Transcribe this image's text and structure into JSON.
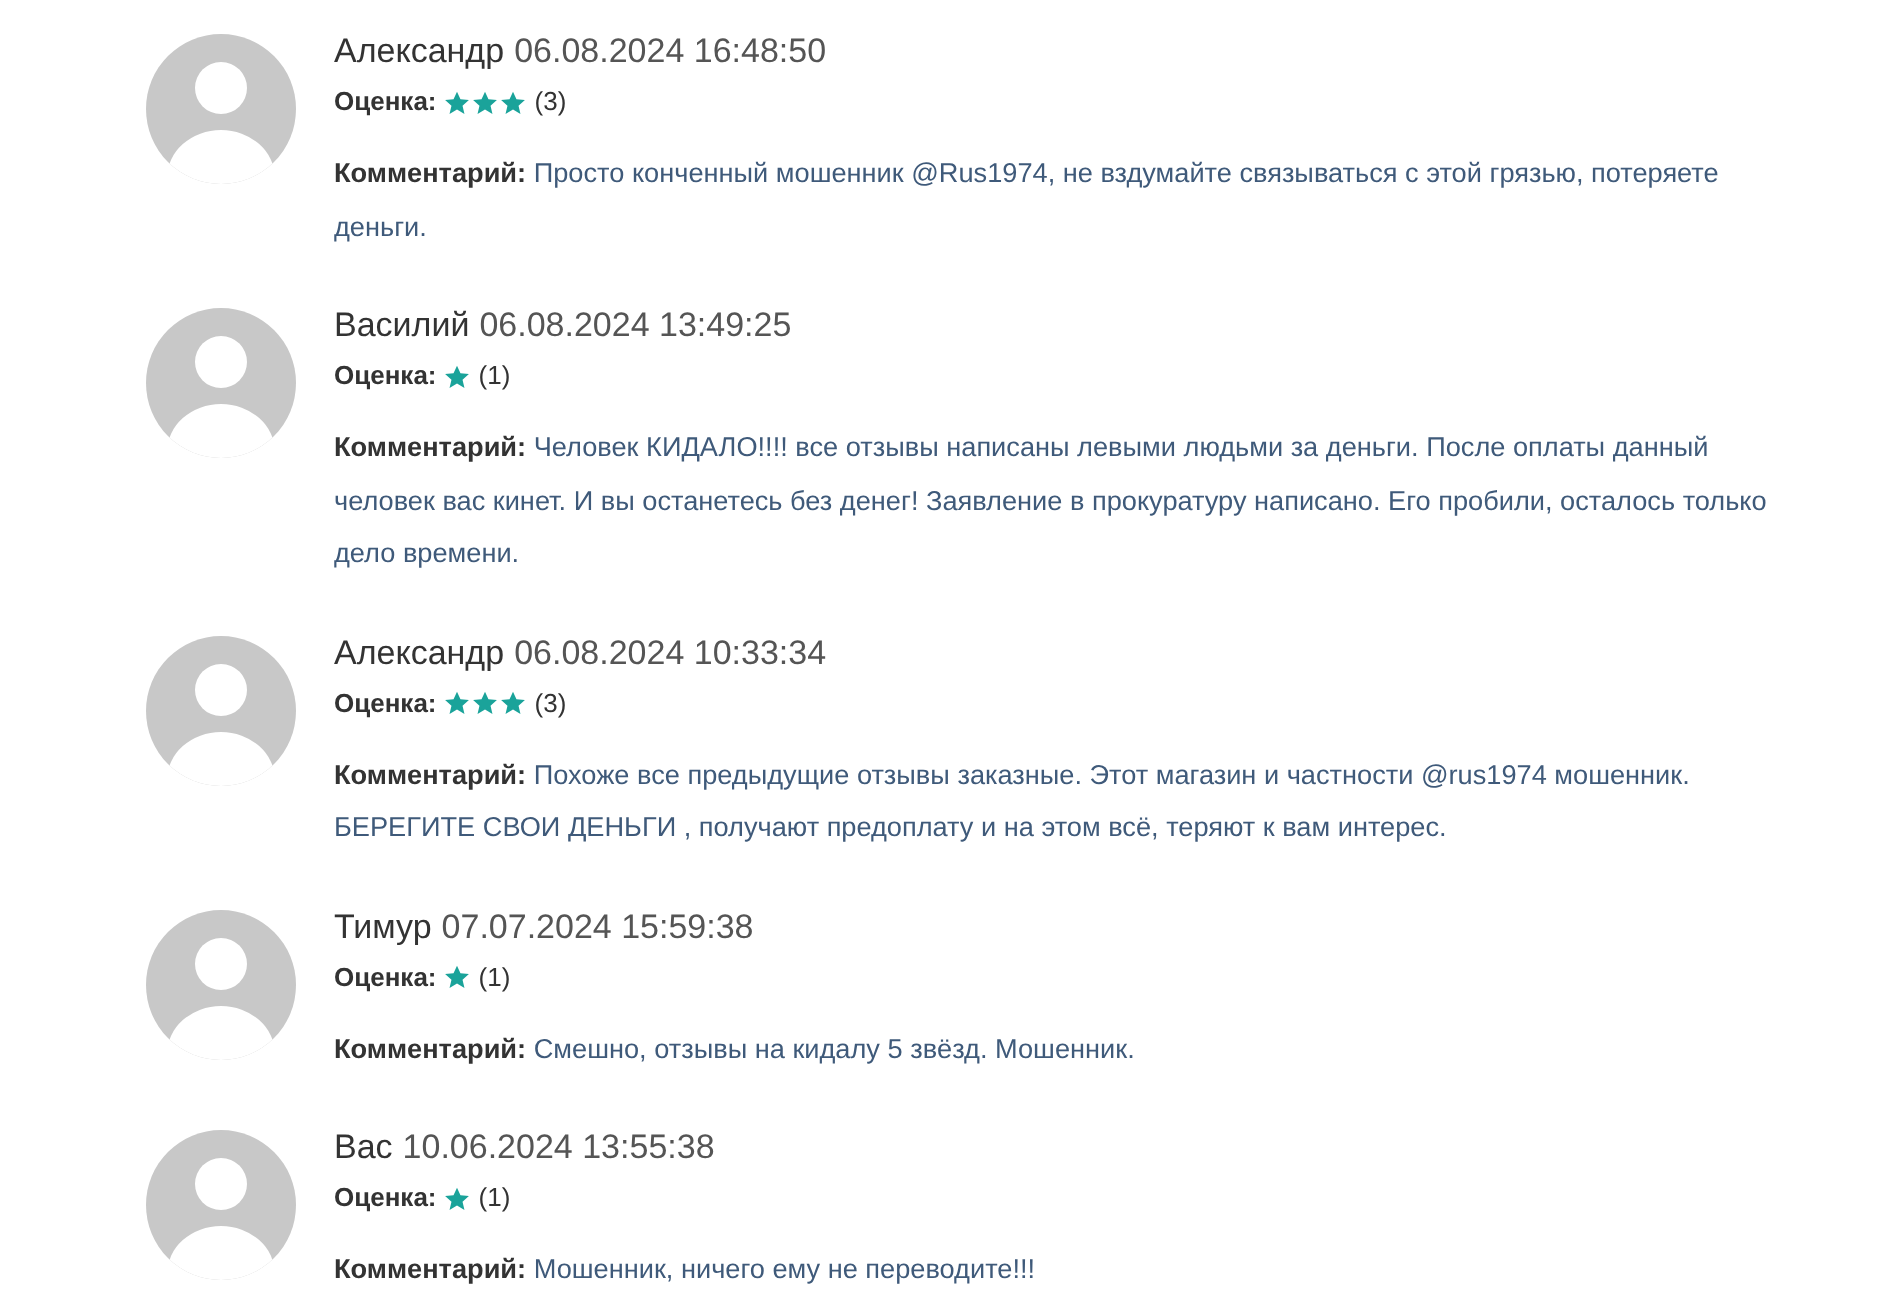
{
  "reviews": [
    {
      "author": "Александр",
      "date": "06.08.2024 16:48:50",
      "rating_label": "Оценка:",
      "stars": 3,
      "rating_count": "(3)",
      "comment": "**Комментарий:** Просто конченный мошенник @Rus1974, не вздумайте связываться с этой грязью, потеряете деньги."
    },
    {
      "author": "Василий",
      "date": "06.08.2024 13:49:25",
      "rating_label": "Оценка:",
      "stars": 1,
      "rating_count": "(1)",
      "comment": "**Комментарий:** Человек КИДАЛО!!!! все отзывы написаны левыми людьми за деньги. После оплаты данный человек вас кинет. И вы останетесь без денег! Заявление в прокуратуру написано. Его пробили, осталось только дело времени."
    },
    {
      "author": "Александр",
      "date": "06.08.2024 10:33:34",
      "rating_label": "Оценка:",
      "stars": 3,
      "rating_count": "(3)",
      "comment": "**Комментарий:** Похоже все предыдущие отзывы заказные. Этот магазин и частности @rus1974 мошенник. БЕРЕГИТЕ СВОИ ДЕНЬГИ , получают предоплату и на этом всё, теряют к вам интерес."
    },
    {
      "author": "Тимур",
      "date": "07.07.2024 15:59:38",
      "rating_label": "Оценка:",
      "stars": 1,
      "rating_count": "(1)",
      "comment": "**Комментарий:** Смешно, отзывы на кидалу 5 звёзд. Мошенник."
    },
    {
      "author": "Вас",
      "date": "10.06.2024 13:55:38",
      "rating_label": "Оценка:",
      "stars": 1,
      "rating_count": "(1)",
      "comment": "**Комментарий:** Мошенник, ничего ему не переводите!!!"
    }
  ]
}
